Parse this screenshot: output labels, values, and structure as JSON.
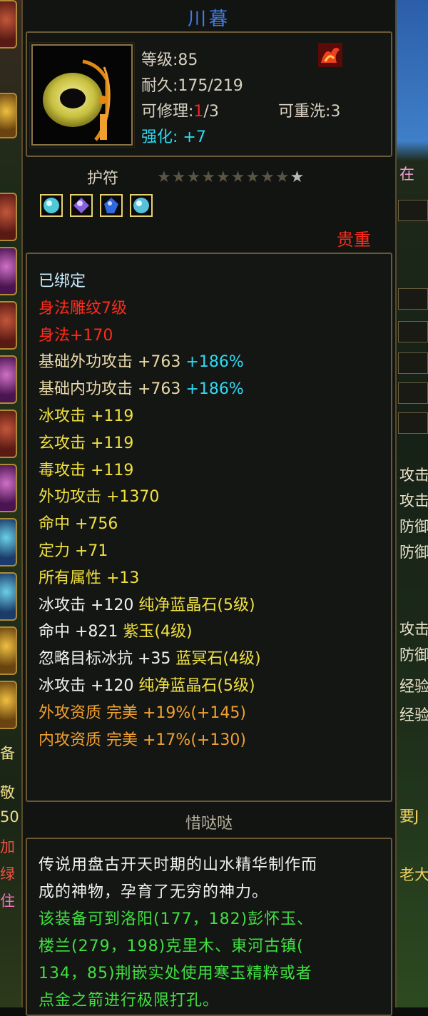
{
  "item": {
    "name": "川暮",
    "level_text": "等级:85",
    "durability_text": "耐久:175/219",
    "repair_label": "可修理:",
    "repair_used": "1",
    "repair_total": "/3",
    "rewash_text": "可重洗:3",
    "enhance_text": "强化: +7",
    "type": "护符",
    "stars_filled": 9,
    "stars_total": 10,
    "star_glyph": "★",
    "rarity": "贵重"
  },
  "attributes": [
    {
      "parts": [
        {
          "text": "已绑定",
          "color": "ltblue"
        }
      ]
    },
    {
      "parts": [
        {
          "text": "身法雕纹7级",
          "color": "red"
        }
      ]
    },
    {
      "parts": [
        {
          "text": "身法+170",
          "color": "red"
        }
      ]
    },
    {
      "parts": [
        {
          "text": "基础外功攻击 +763 ",
          "color": "tan"
        },
        {
          "text": "+186%",
          "color": "cyan"
        }
      ]
    },
    {
      "parts": [
        {
          "text": "基础内功攻击 +763 ",
          "color": "tan"
        },
        {
          "text": "+186%",
          "color": "cyan"
        }
      ]
    },
    {
      "parts": [
        {
          "text": "冰攻击 +119",
          "color": "yellow"
        }
      ]
    },
    {
      "parts": [
        {
          "text": "玄攻击 +119",
          "color": "yellow"
        }
      ]
    },
    {
      "parts": [
        {
          "text": "毒攻击 +119",
          "color": "yellow"
        }
      ]
    },
    {
      "parts": [
        {
          "text": "外功攻击 +1370",
          "color": "yellow"
        }
      ]
    },
    {
      "parts": [
        {
          "text": "命中 +756",
          "color": "yellow"
        }
      ]
    },
    {
      "parts": [
        {
          "text": "定力 +71",
          "color": "yellow"
        }
      ]
    },
    {
      "parts": [
        {
          "text": "所有属性 +13",
          "color": "yellow"
        }
      ]
    },
    {
      "parts": [
        {
          "text": "冰攻击 +120 ",
          "color": "white"
        },
        {
          "text": "纯净蓝晶石(5级)",
          "color": "yellow"
        }
      ]
    },
    {
      "parts": [
        {
          "text": "命中 +821 ",
          "color": "white"
        },
        {
          "text": "紫玉(4级)",
          "color": "yellow"
        }
      ]
    },
    {
      "parts": [
        {
          "text": "忽略目标冰抗 +35 ",
          "color": "white"
        },
        {
          "text": "蓝冥石(4级)",
          "color": "yellow"
        }
      ]
    },
    {
      "parts": [
        {
          "text": "冰攻击 +120 ",
          "color": "white"
        },
        {
          "text": "纯净蓝晶石(5级)",
          "color": "yellow"
        }
      ]
    },
    {
      "parts": [
        {
          "text": "外攻资质  完美 +19%(+145)",
          "color": "orange"
        }
      ]
    },
    {
      "parts": [
        {
          "text": "内攻资质  完美 +17%(+130)",
          "color": "orange"
        }
      ]
    }
  ],
  "owner": "惜哒哒",
  "description": [
    {
      "text": "传说用盘古开天时期的山水精华制作而",
      "color": "white"
    },
    {
      "text": "成的神物，孕育了无穷的神力。",
      "color": "white"
    },
    {
      "text": "该装备可到洛阳(177，182)彭怀玉、",
      "color": "green"
    },
    {
      "text": "楼兰(279，198)克里木、東河古镇(",
      "color": "green"
    },
    {
      "text": "134，85)荆嵌实处使用寒玉精粹或者",
      "color": "green"
    },
    {
      "text": "点金之箭进行极限打孔。",
      "color": "green"
    }
  ],
  "background_right": {
    "texts": [
      "在",
      "攻击",
      "攻击",
      "防御",
      "防御",
      "攻击",
      "防御",
      "经验",
      "经验",
      "要J",
      "老大"
    ]
  },
  "background_left": {
    "texts": [
      "备",
      "敬",
      "50",
      "加",
      "绿",
      "住"
    ]
  },
  "colors": {
    "title": "#3f7de8",
    "red": "#ff2a1a",
    "cyan": "#30d8f0",
    "yellow": "#f0e040",
    "orange": "#f0a030",
    "green": "#40e040",
    "frame": "#6b5a35"
  }
}
